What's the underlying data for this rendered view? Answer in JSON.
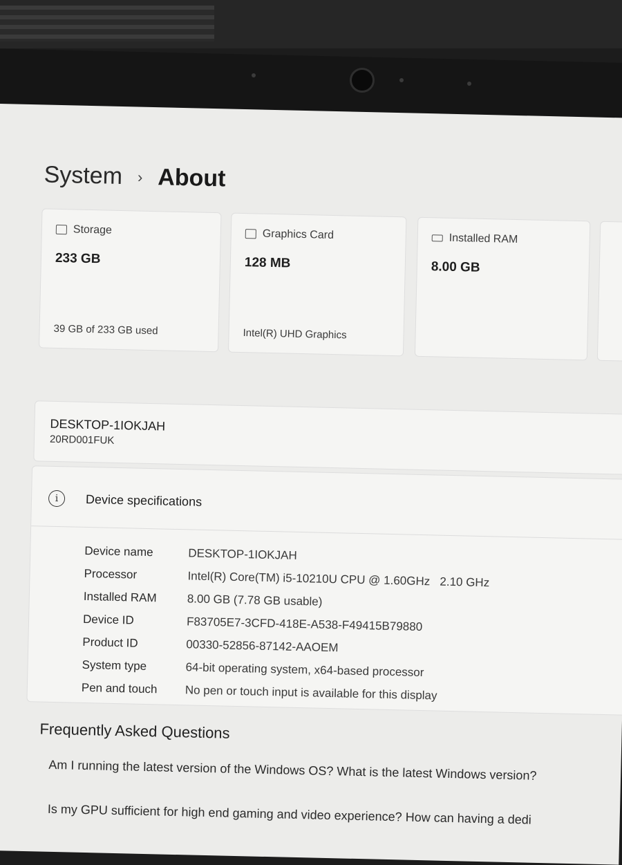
{
  "breadcrumb": {
    "parent": "System",
    "current": "About"
  },
  "cards": [
    {
      "icon": "storage-icon",
      "label": "Storage",
      "value": "233 GB",
      "sub": "39 GB of 233 GB used"
    },
    {
      "icon": "graphics-card-icon",
      "label": "Graphics Card",
      "value": "128 MB",
      "sub": "Intel(R) UHD Graphics"
    },
    {
      "icon": "ram-icon",
      "label": "Installed RAM",
      "value": "8.00 GB",
      "sub": ""
    }
  ],
  "device": {
    "name": "DESKTOP-1IOKJAH",
    "model": "20RD001FUK"
  },
  "specs": {
    "title": "Device specifications",
    "rows": [
      {
        "k": "Device name",
        "v": "DESKTOP-1IOKJAH"
      },
      {
        "k": "Processor",
        "v": "Intel(R) Core(TM) i5-10210U CPU @ 1.60GHz   2.10 GHz"
      },
      {
        "k": "Installed RAM",
        "v": "8.00 GB (7.78 GB usable)"
      },
      {
        "k": "Device ID",
        "v": "F83705E7-3CFD-418E-A538-F49415B79880"
      },
      {
        "k": "Product ID",
        "v": "00330-52856-87142-AAOEM"
      },
      {
        "k": "System type",
        "v": "64-bit operating system, x64-based processor"
      },
      {
        "k": "Pen and touch",
        "v": "No pen or touch input is available for this display"
      }
    ]
  },
  "faq": {
    "title": "Frequently Asked Questions",
    "q1": "Am I running the latest version of the Windows OS? What is the latest Windows version?",
    "q2": "Is my GPU sufficient for high end gaming and video experience? How can having a dedi"
  }
}
